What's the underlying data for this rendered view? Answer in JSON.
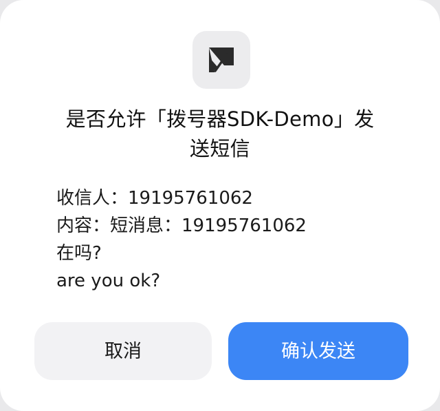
{
  "dialog": {
    "app_icon": "edit-note-icon",
    "title_line1": "是否允许「拨号器SDK-Demo」发",
    "title_line2": "送短信",
    "recipient": "收信人：19195761062",
    "content_line1": "内容：短消息：19195761062",
    "content_line2": "在吗?",
    "content_line3": "are you ok?",
    "cancel_label": "取消",
    "confirm_label": "确认发送"
  },
  "colors": {
    "confirm_button": "#3c86f5",
    "cancel_button": "#f2f2f4",
    "icon_background": "#ececee",
    "icon_foreground": "#2b2b2b"
  }
}
